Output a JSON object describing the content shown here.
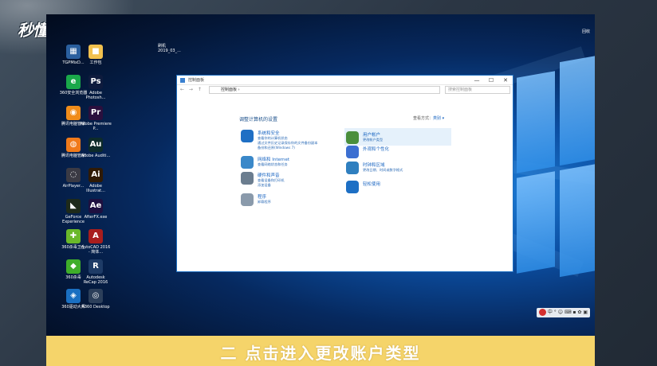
{
  "brand": {
    "logo_text": "秒懂视频",
    "clip_name": "刷机",
    "clip_date": "2019_03_..."
  },
  "desktop": {
    "top_right_label": "回收",
    "icons": [
      {
        "label": "TGPMixD...",
        "color": "#2a5f9e",
        "glyph": "▦"
      },
      {
        "label": "工作包",
        "color": "#f2c14e",
        "glyph": "■"
      },
      {
        "label": "360安全浏览器",
        "color": "#1aa84a",
        "glyph": "e"
      },
      {
        "label": "Adobe Photosh...",
        "color": "#0e1b3d",
        "glyph": "Ps"
      },
      {
        "label": "腾讯电脑管家",
        "color": "#f08c1a",
        "glyph": "◉"
      },
      {
        "label": "Adobe Premiere P...",
        "color": "#2a0f3d",
        "glyph": "Pr"
      },
      {
        "label": "腾讯电脑管家",
        "color": "#f07a1a",
        "glyph": "◍"
      },
      {
        "label": "Adobe Auditi...",
        "color": "#0d2b2a",
        "glyph": "Au"
      },
      {
        "label": "AirPlayer...",
        "color": "#3a3a44",
        "glyph": "◌"
      },
      {
        "label": "Adobe Illustrat...",
        "color": "#2f1a05",
        "glyph": "Ai"
      },
      {
        "label": "GeForce Experience",
        "color": "#1e2a1a",
        "glyph": "◣"
      },
      {
        "label": "AfterFX.exe",
        "color": "#1e1040",
        "glyph": "Ae"
      },
      {
        "label": "360杀毒卫士",
        "color": "#6ab82a",
        "glyph": "✚"
      },
      {
        "label": "AutoCAD 2016 - 简体...",
        "color": "#a81d1d",
        "glyph": "A"
      },
      {
        "label": "360杀毒",
        "color": "#3fae2a",
        "glyph": "◆"
      },
      {
        "label": "Autodesk ReCap 2016",
        "color": "#1e3b66",
        "glyph": "R"
      },
      {
        "label": "360驱动大师",
        "color": "#1a6fc1",
        "glyph": "◈"
      },
      {
        "label": "A360 Desktop",
        "color": "#2c3f5a",
        "glyph": "◎"
      }
    ]
  },
  "window": {
    "title": "控制面板",
    "minimize": "—",
    "maximize": "☐",
    "close": "✕",
    "nav": "← → ↑",
    "address": "控制面板 ›",
    "search_placeholder": "搜索控制面板",
    "heading": "调整计算机的设置",
    "view_by_label": "查看方式：",
    "view_by_value": "类别 ▾",
    "categories_left": [
      {
        "title": "系统和安全",
        "links": [
          "查看你的计算机状态",
          "通过文件历史记录保存你的文件备份副本",
          "备份和还原(Windows 7)"
        ],
        "color": "#1f6fc4"
      },
      {
        "title": "网络和 Internet",
        "links": [
          "查看网络状态和任务"
        ],
        "color": "#3a88c9"
      },
      {
        "title": "硬件和声音",
        "links": [
          "查看设备和打印机",
          "添加设备"
        ],
        "color": "#6b7d8f"
      },
      {
        "title": "程序",
        "links": [
          "卸载程序"
        ],
        "color": "#8a9aab"
      }
    ],
    "categories_right": [
      {
        "title": "用户帐户",
        "links": [
          "更改帐户类型"
        ],
        "color": "#4a8f3c"
      },
      {
        "title": "外观和个性化",
        "links": [],
        "color": "#3c6fd1"
      },
      {
        "title": "时钟和区域",
        "links": [
          "更改日期、时间或数字格式"
        ],
        "color": "#2f7fbf"
      },
      {
        "title": "轻松使用",
        "links": [],
        "color": "#1d6fc4"
      }
    ]
  },
  "tray": {
    "logo": "S",
    "items": "中 ° ☺ ⌨ ▪ ✿ ▣"
  },
  "caption": "二 点击进入更改账户类型"
}
